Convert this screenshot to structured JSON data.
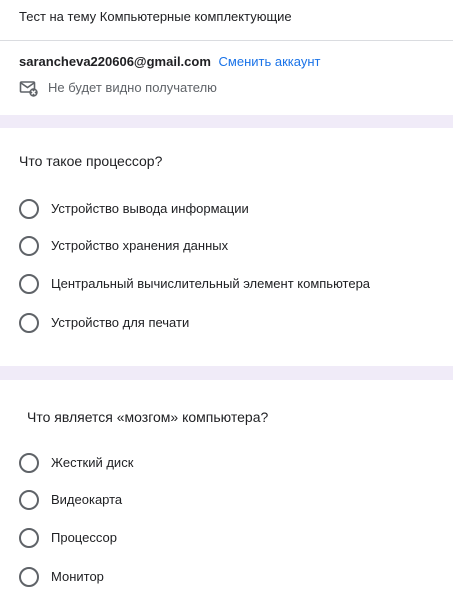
{
  "form": {
    "title": "Тест на тему Компьютерные комплектующие"
  },
  "account": {
    "email": "sarancheva220606@gmail.com",
    "switch_label": "Сменить аккаунт",
    "privacy_icon": "mail-hidden-icon",
    "privacy_text": "Не будет видно получателю"
  },
  "questions": [
    {
      "title": "Что такое процессор?",
      "options": [
        "Устройство вывода информации",
        "Устройство хранения данных",
        "Центральный вычислительный элемент компьютера",
        "Устройство для печати"
      ]
    },
    {
      "title": "Что является «мозгом» компьютера?",
      "options": [
        "Жесткий диск",
        "Видеокарта",
        "Процессор",
        "Монитор"
      ]
    }
  ],
  "colors": {
    "page_background": "#f0ebf8",
    "card_background": "#ffffff",
    "link": "#1a73e8",
    "radio_border": "#5f6368"
  }
}
